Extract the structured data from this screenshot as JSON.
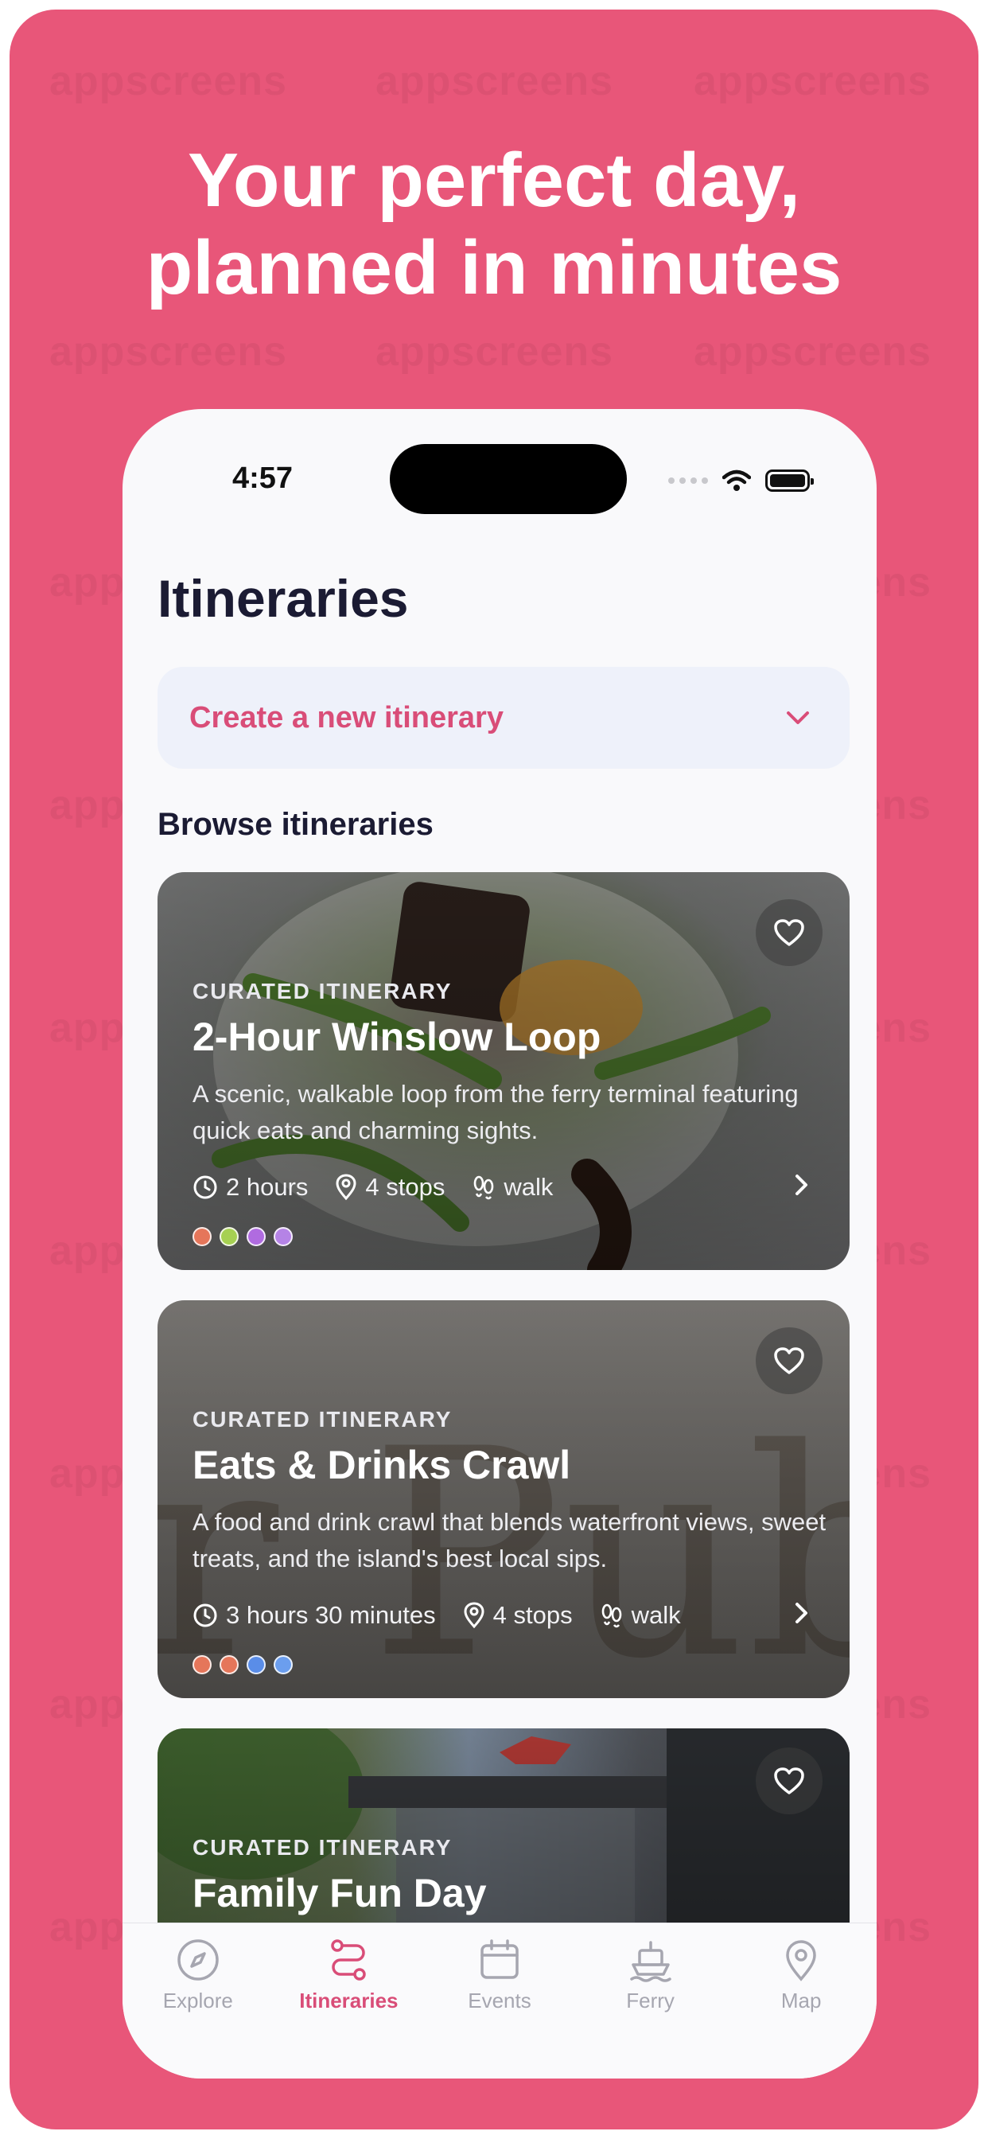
{
  "headline": [
    "Your perfect day,",
    "planned in minutes"
  ],
  "watermark_text": "appscreens",
  "colors": {
    "background": "#e85679",
    "accent": "#d94d78",
    "title": "#1b1b33"
  },
  "status_bar": {
    "time": "4:57"
  },
  "page": {
    "title": "Itineraries",
    "create_label": "Create a new itinerary",
    "section_title": "Browse itineraries"
  },
  "cards": [
    {
      "kicker": "CURATED ITINERARY",
      "title": "2-Hour Winslow Loop",
      "description": "A scenic, walkable loop from the ferry terminal featuring quick eats and charming sights.",
      "duration": "2 hours",
      "stops": "4 stops",
      "mode": "walk",
      "dot_colors": [
        "#e5765a",
        "#a6d052",
        "#b06be0",
        "#b583e6"
      ]
    },
    {
      "kicker": "CURATED ITINERARY",
      "title": "Eats & Drinks Crawl",
      "description": "A food and drink crawl that blends waterfront views, sweet treats, and the island's best local sips.",
      "duration": "3 hours 30 minutes",
      "stops": "4 stops",
      "mode": "walk",
      "dot_colors": [
        "#e5765a",
        "#e5765a",
        "#5a8de8",
        "#6b9eee"
      ]
    },
    {
      "kicker": "CURATED ITINERARY",
      "title": "Family Fun Day"
    }
  ],
  "tabs": [
    {
      "label": "Explore",
      "icon": "compass-icon",
      "active": false
    },
    {
      "label": "Itineraries",
      "icon": "route-icon",
      "active": true
    },
    {
      "label": "Events",
      "icon": "calendar-icon",
      "active": false
    },
    {
      "label": "Ferry",
      "icon": "ferry-icon",
      "active": false
    },
    {
      "label": "Map",
      "icon": "map-pin-icon",
      "active": false
    }
  ]
}
